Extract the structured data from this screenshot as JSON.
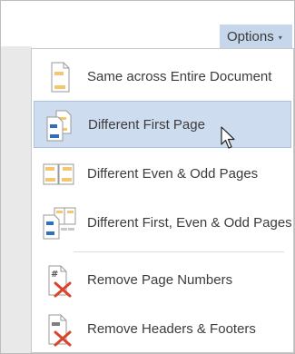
{
  "options_button": {
    "label": "Options",
    "caret": "▾"
  },
  "menu": {
    "items": [
      {
        "label": "Same across Entire Document",
        "icon": "same-across-document-icon"
      },
      {
        "label": "Different First Page",
        "icon": "different-first-page-icon",
        "highlighted": true
      },
      {
        "label": "Different Even & Odd Pages",
        "icon": "different-even-odd-icon"
      },
      {
        "label": "Different First, Even & Odd Pages",
        "icon": "different-first-even-odd-icon"
      },
      {
        "label": "Remove Page Numbers",
        "icon": "remove-page-numbers-icon"
      },
      {
        "label": "Remove Headers & Footers",
        "icon": "remove-headers-footers-icon"
      }
    ]
  },
  "colors": {
    "accent_blue": "#2e6fc0",
    "header_yellow": "#f3c770",
    "remove_red": "#d9442a",
    "hover_bg": "#cddcef",
    "options_bg": "#c6d7ec"
  }
}
